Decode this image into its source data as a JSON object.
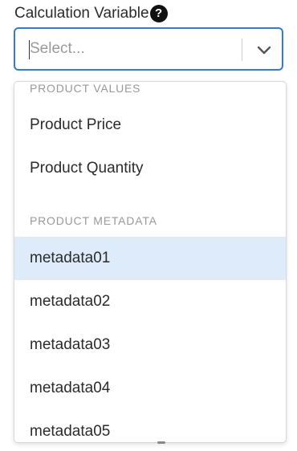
{
  "field": {
    "label": "Calculation Variable",
    "help_icon": "question-circle-icon",
    "help_glyph": "?"
  },
  "select": {
    "placeholder": "Select...",
    "indicator_icon": "chevron-down-icon"
  },
  "menu": {
    "groups": [
      {
        "header": "PRODUCT VALUES",
        "options": [
          "Product Price",
          "Product Quantity"
        ]
      },
      {
        "header": "PRODUCT METADATA",
        "options": [
          "metadata01",
          "metadata02",
          "metadata03",
          "metadata04",
          "metadata05"
        ]
      }
    ],
    "focused_option": "metadata01"
  },
  "colors": {
    "focus_border": "#2f7be0",
    "option_highlight": "#deebfb",
    "group_header_text": "#999999"
  }
}
